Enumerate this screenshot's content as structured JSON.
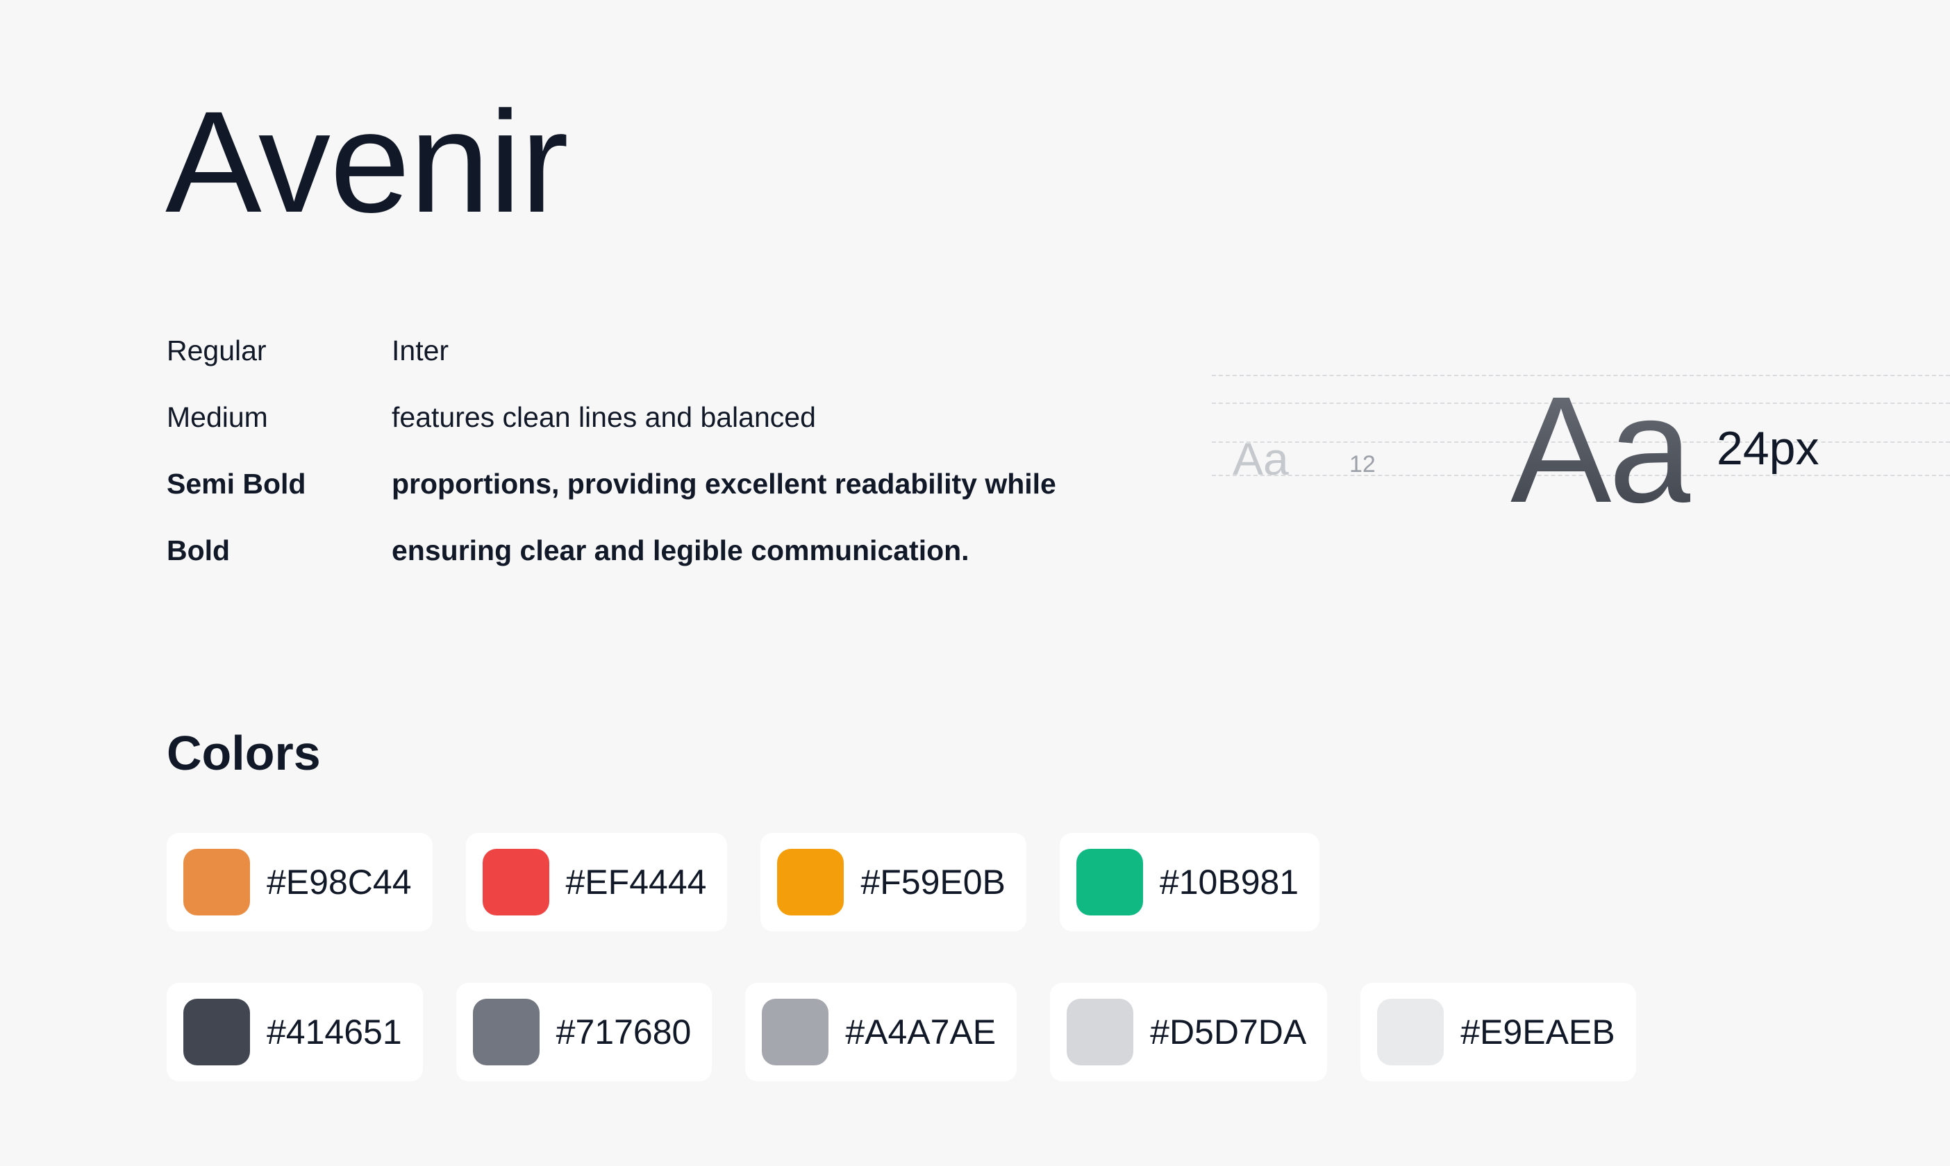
{
  "title": "Avenir",
  "weights": [
    {
      "name": "Regular",
      "sample": "Inter"
    },
    {
      "name": "Medium",
      "sample": "features clean lines and balanced"
    },
    {
      "name": "Semi Bold",
      "sample": "proportions, providing excellent readability while"
    },
    {
      "name": "Bold",
      "sample": "ensuring clear and legible communication."
    }
  ],
  "specimen": {
    "small_glyph": "Aa",
    "small_size": "12",
    "large_glyph": "Aa",
    "large_size": "24px"
  },
  "colors": {
    "heading": "Colors",
    "row1": [
      {
        "hex": "#E98C44",
        "label": "#E98C44"
      },
      {
        "hex": "#EF4444",
        "label": "#EF4444"
      },
      {
        "hex": "#F59E0B",
        "label": "#F59E0B"
      },
      {
        "hex": "#10B981",
        "label": "#10B981"
      }
    ],
    "row2": [
      {
        "hex": "#414651",
        "label": "#414651"
      },
      {
        "hex": "#717680",
        "label": "#717680"
      },
      {
        "hex": "#A4A7AE",
        "label": "#A4A7AE"
      },
      {
        "hex": "#D5D7DA",
        "label": "#D5D7DA"
      },
      {
        "hex": "#E9EAEB",
        "label": "#E9EAEB"
      }
    ]
  }
}
